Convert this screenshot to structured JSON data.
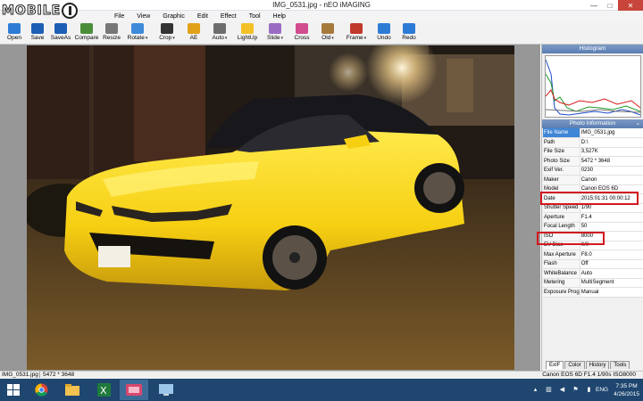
{
  "window": {
    "title": "IMG_0531.jpg - nEO iMAGING",
    "minimize": "—",
    "maximize": "□",
    "close": "✕"
  },
  "watermark": {
    "text": "MOBILE"
  },
  "menu": [
    "File",
    "View",
    "Graphic",
    "Edit",
    "Effect",
    "Tool",
    "Help"
  ],
  "toolbar": [
    {
      "label": "Open",
      "icon": "open-icon",
      "color": "#2e7bd6",
      "dropdown": false
    },
    {
      "label": "Save",
      "icon": "save-icon",
      "color": "#1d5fb5",
      "dropdown": false
    },
    {
      "label": "SaveAs",
      "icon": "save-as-icon",
      "color": "#1d5fb5",
      "dropdown": false
    },
    {
      "label": "Compare",
      "icon": "compare-icon",
      "color": "#4a8e3a",
      "dropdown": false
    },
    {
      "label": "Resize",
      "icon": "resize-icon",
      "color": "#777777",
      "dropdown": false
    },
    {
      "label": "Rotate",
      "icon": "rotate-icon",
      "color": "#3d8bd9",
      "dropdown": true
    },
    {
      "label": "Crop",
      "icon": "crop-icon",
      "color": "#333333",
      "dropdown": true
    },
    {
      "label": "AE",
      "icon": "ae-icon",
      "color": "#e0a21a",
      "dropdown": false
    },
    {
      "label": "Auto",
      "icon": "auto-icon",
      "color": "#6d6d6d",
      "dropdown": true
    },
    {
      "label": "LightUp",
      "icon": "lightup-icon",
      "color": "#f2c027",
      "dropdown": false
    },
    {
      "label": "Slide",
      "icon": "slide-icon",
      "color": "#9a6cc4",
      "dropdown": true
    },
    {
      "label": "Cross",
      "icon": "cross-icon",
      "color": "#d24b8f",
      "dropdown": false
    },
    {
      "label": "Old",
      "icon": "old-icon",
      "color": "#a57a3c",
      "dropdown": true
    },
    {
      "label": "Frame",
      "icon": "frame-icon",
      "color": "#c0392b",
      "dropdown": true
    },
    {
      "label": "Undo",
      "icon": "undo-icon",
      "color": "#2e7bd6",
      "dropdown": false
    },
    {
      "label": "Redo",
      "icon": "redo-icon",
      "color": "#2e7bd6",
      "dropdown": false
    }
  ],
  "panel": {
    "histogram_title": "Histogram",
    "info_title": "Photo Information",
    "rows": [
      {
        "key": "File Name",
        "value": "IMG_0531.jpg"
      },
      {
        "key": "Path",
        "value": "D:\\"
      },
      {
        "key": "File Size",
        "value": "3,527K"
      },
      {
        "key": "Photo Size",
        "value": "5472 * 3648"
      },
      {
        "key": "Exif Ver.",
        "value": "0230"
      },
      {
        "key": "Maker",
        "value": "Canon"
      },
      {
        "key": "Model",
        "value": "Canon EOS 6D"
      },
      {
        "key": "Date",
        "value": "2015:01:31 00:00:12"
      },
      {
        "key": "Shutter Speed",
        "value": "1/90"
      },
      {
        "key": "Aperture",
        "value": "F1.4"
      },
      {
        "key": "Focal Length",
        "value": "50"
      },
      {
        "key": "ISO",
        "value": "8000"
      },
      {
        "key": "EV Bias",
        "value": "0/0"
      },
      {
        "key": "Max Aperture",
        "value": "F8.0"
      },
      {
        "key": "Flash",
        "value": "Off"
      },
      {
        "key": "WhiteBalance",
        "value": "Auto"
      },
      {
        "key": "Metering",
        "value": "MultiSegment"
      },
      {
        "key": "Exposure Prog",
        "value": "Manual"
      }
    ],
    "tabs": [
      "ExIF",
      "Color",
      "History",
      "Tools"
    ]
  },
  "status": {
    "filename": "IMG_0531.jpg",
    "dims": "5472 * 3648",
    "exif": "Canon EOS 6D F1.4 1/90s ISO8000"
  },
  "taskbar": {
    "lang": "ENG",
    "time": "7:35 PM",
    "date": "4/26/2015"
  },
  "accent": "#d2171f"
}
